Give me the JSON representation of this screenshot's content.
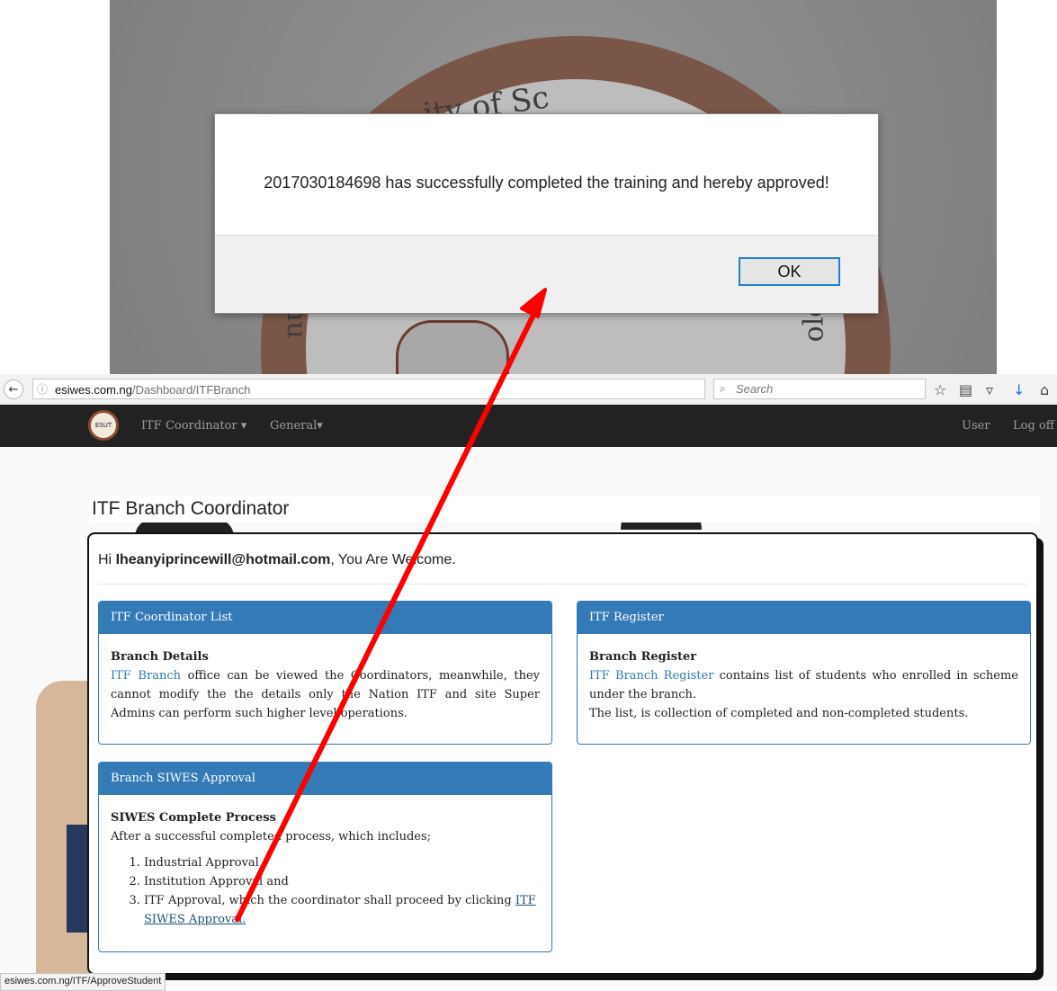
{
  "dialog": {
    "message": "2017030184698 has successfully completed the training and hereby approved!",
    "ok_label": "OK"
  },
  "background_seal": {
    "text_top": "ity of Sc",
    "text_left": "nu",
    "text_right": "olo"
  },
  "browser": {
    "back_icon": "←",
    "url_domain": "esiwes.com.ng",
    "url_path": "/Dashboard/ITFBranch",
    "reload_icon": "↻",
    "search_placeholder": "Search",
    "toolbar_icons": [
      "star-icon",
      "reading-list-icon",
      "pocket-icon",
      "download-icon",
      "home-icon"
    ]
  },
  "navbar": {
    "logo_text": "ESUT",
    "menu_itf": "ITF Coordinator ▾",
    "menu_general": "General▾",
    "user": "User",
    "logoff": "Log off"
  },
  "page": {
    "title": "ITF Branch Coordinator",
    "welcome_prefix": "Hi ",
    "welcome_email": "Iheanyiprincewill@hotmail.com",
    "welcome_suffix": ", You Are Welcome."
  },
  "panels": {
    "coordinator": {
      "header": "ITF Coordinator List",
      "heading": "Branch Details",
      "link": "ITF Branch",
      "text": " office can be viewed the Coordinators, meanwhile, they cannot modify the the details only the Nation ITF and site Super Admins can perform such higher level operations."
    },
    "register": {
      "header": "ITF Register",
      "heading": "Branch Register",
      "link": "ITF Branch Register",
      "text": " contains list of students who enrolled in scheme under the branch.",
      "text2": "The list, is collection of completed and non-completed students."
    },
    "approval": {
      "header": "Branch SIWES Approval",
      "heading": "SIWES Complete Process",
      "intro": "After a successful completed process, which includes;",
      "item1": "Industrial Approval",
      "item2": "Institution Approval and",
      "item3": "ITF Approval, which the coordinator shall proceed by clicking ",
      "item3_link": "ITF SIWES Approval."
    }
  },
  "status_bar": "esiwes.com.ng/ITF/ApproveStudent",
  "colors": {
    "primary": "#337ab7",
    "navbar": "#222222",
    "arrow": "#ff0000"
  }
}
